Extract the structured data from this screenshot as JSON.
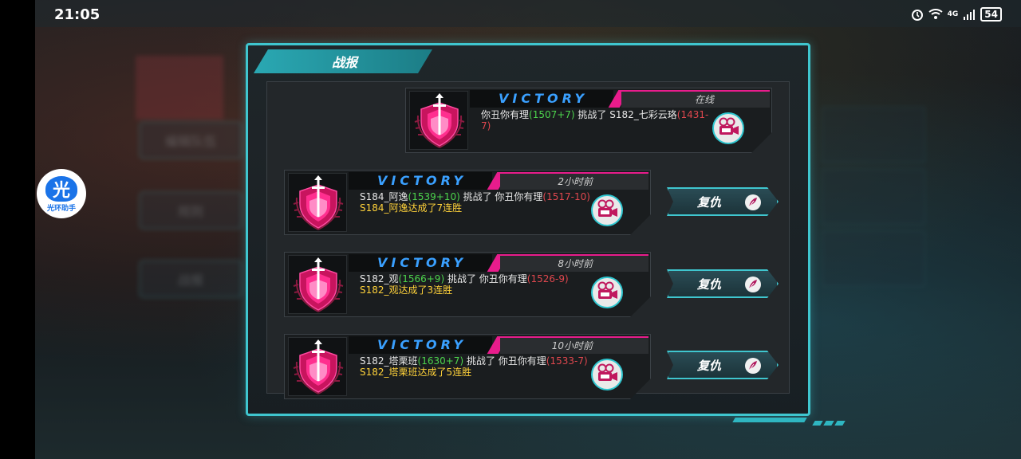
{
  "status_bar": {
    "time": "21:05",
    "network": "4G",
    "battery": "54"
  },
  "assistant": {
    "glyph": "光",
    "label": "光环助手"
  },
  "background": {
    "side_buttons": [
      "编辑队伍",
      "规则",
      "战报"
    ]
  },
  "panel": {
    "title": "战报"
  },
  "entries": [
    {
      "result": "VICTORY",
      "time": "在线",
      "attacker": "你丑你有理",
      "attacker_score": "(1507+7)",
      "verb": " 挑战了 ",
      "defender": "S182_七彩云珞",
      "defender_score": "(1431-7)",
      "streak": "",
      "revenge_label": ""
    },
    {
      "result": "VICTORY",
      "time": "2小时前",
      "attacker": "S184_阿逸",
      "attacker_score": "(1539+10)",
      "verb": " 挑战了 ",
      "defender": "你丑你有理",
      "defender_score": "(1517-10)",
      "streak": "S184_阿逸达成了7连胜",
      "revenge_label": "复仇"
    },
    {
      "result": "VICTORY",
      "time": "8小时前",
      "attacker": "S182_观",
      "attacker_score": "(1566+9)",
      "verb": " 挑战了 ",
      "defender": "你丑你有理",
      "defender_score": "(1526-9)",
      "streak": "S182_观达成了3连胜",
      "revenge_label": "复仇"
    },
    {
      "result": "VICTORY",
      "time": "10小时前",
      "attacker": "S182_塔栗班",
      "attacker_score": "(1630+7)",
      "verb": " 挑战了 ",
      "defender": "你丑你有理",
      "defender_score": "(1533-7)",
      "streak": "S182_塔栗班达成了5连胜",
      "revenge_label": "复仇"
    }
  ],
  "colors": {
    "accent": "#3fc6cf",
    "victory": "#3aa0ff",
    "pink": "#e81c8c",
    "gain": "#4cd34c",
    "loss": "#e0474e",
    "streak": "#ffd23a"
  },
  "icons": {
    "replay": "video-camera-icon",
    "revenge": "quill-icon"
  }
}
